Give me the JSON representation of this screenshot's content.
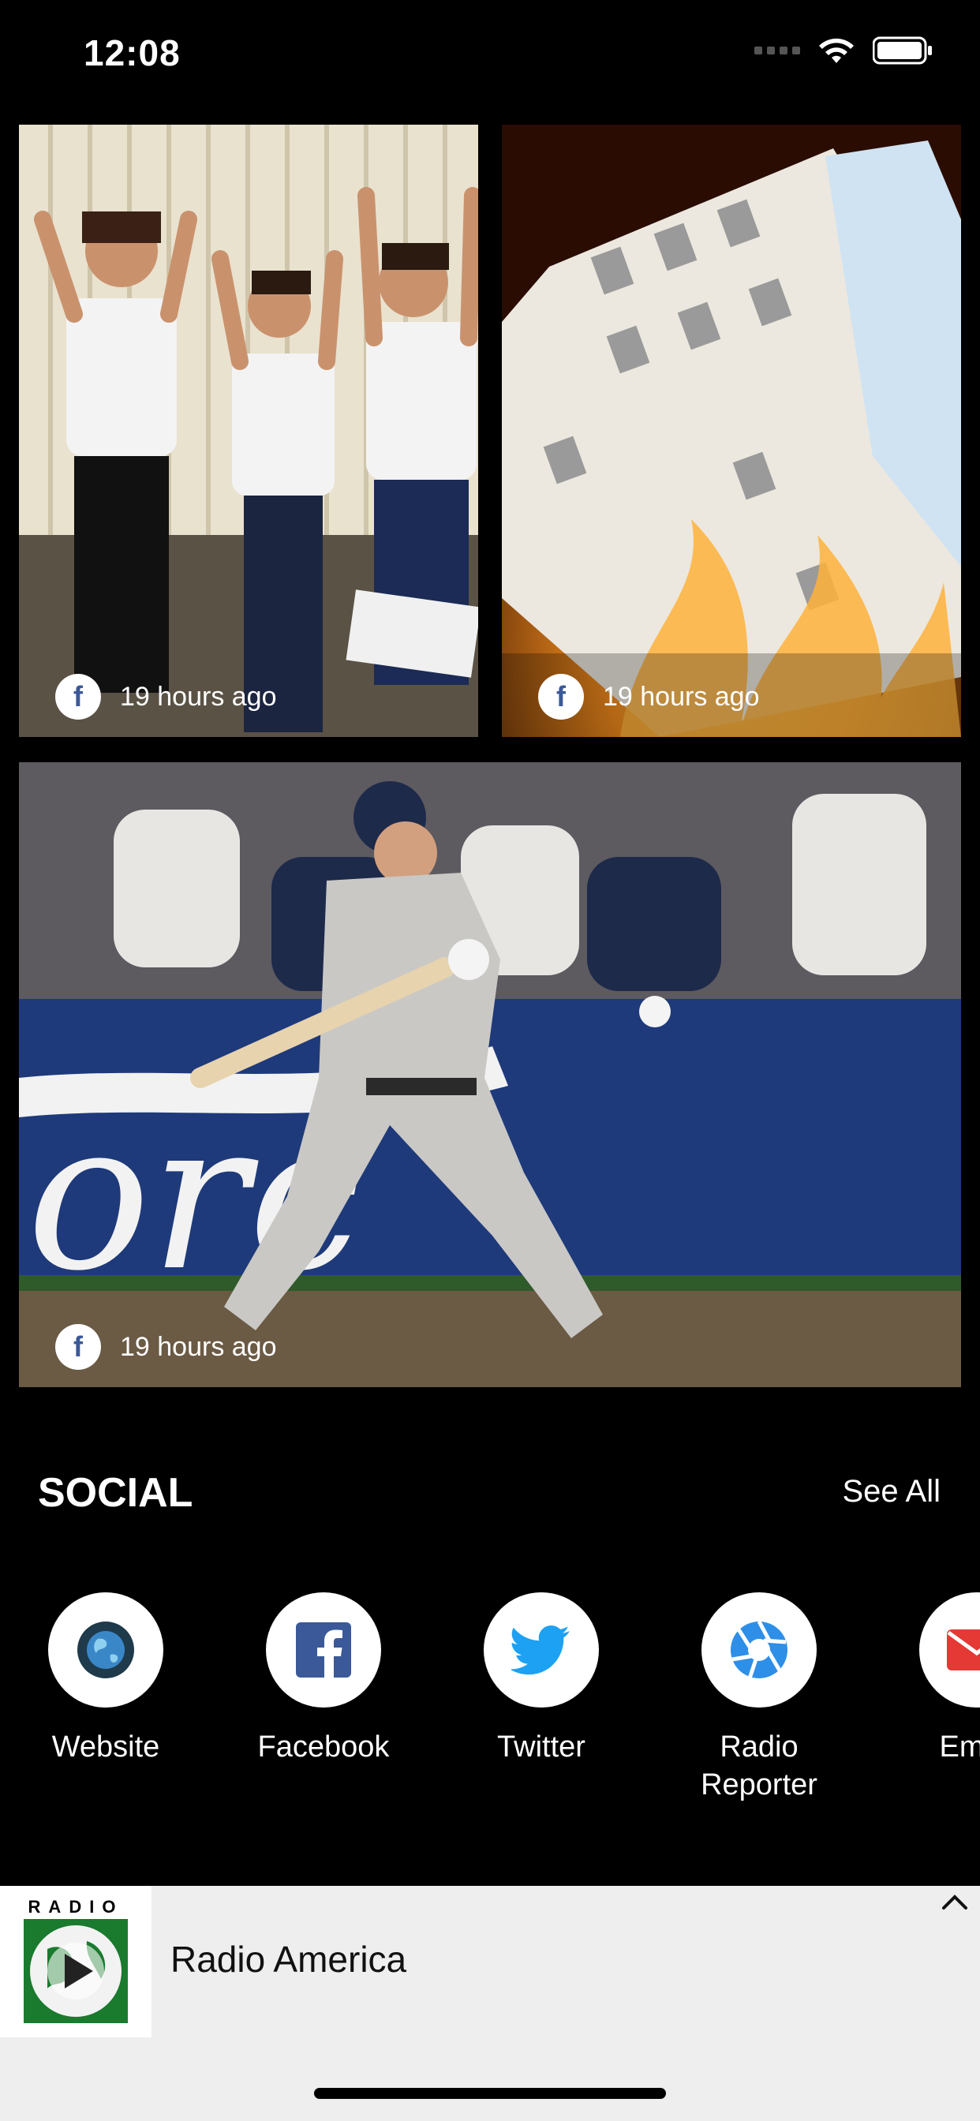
{
  "status_bar": {
    "time": "12:08"
  },
  "feed": {
    "tiles": [
      {
        "time": "19 hours ago",
        "source_icon": "facebook-icon"
      },
      {
        "time": "19 hours ago",
        "source_icon": "facebook-icon"
      },
      {
        "time": "19 hours ago",
        "source_icon": "facebook-icon"
      }
    ]
  },
  "social": {
    "title": "SOCIAL",
    "see_all": "See All",
    "items": [
      {
        "label": "Website",
        "icon": "globe-icon"
      },
      {
        "label": "Facebook",
        "icon": "facebook-icon"
      },
      {
        "label": "Twitter",
        "icon": "twitter-bird-icon"
      },
      {
        "label": "Radio\nReporter",
        "icon": "camera-aperture-icon"
      },
      {
        "label": "Email",
        "icon": "envelope-icon"
      }
    ]
  },
  "player": {
    "station": "Radio America",
    "logo_text": "RADIO AMERICA"
  },
  "colors": {
    "facebook_blue": "#3b5998",
    "twitter_blue": "#1da1f2",
    "reporter_blue": "#2e8fe8",
    "email_red": "#e53935",
    "player_bg": "#eeeeee"
  }
}
